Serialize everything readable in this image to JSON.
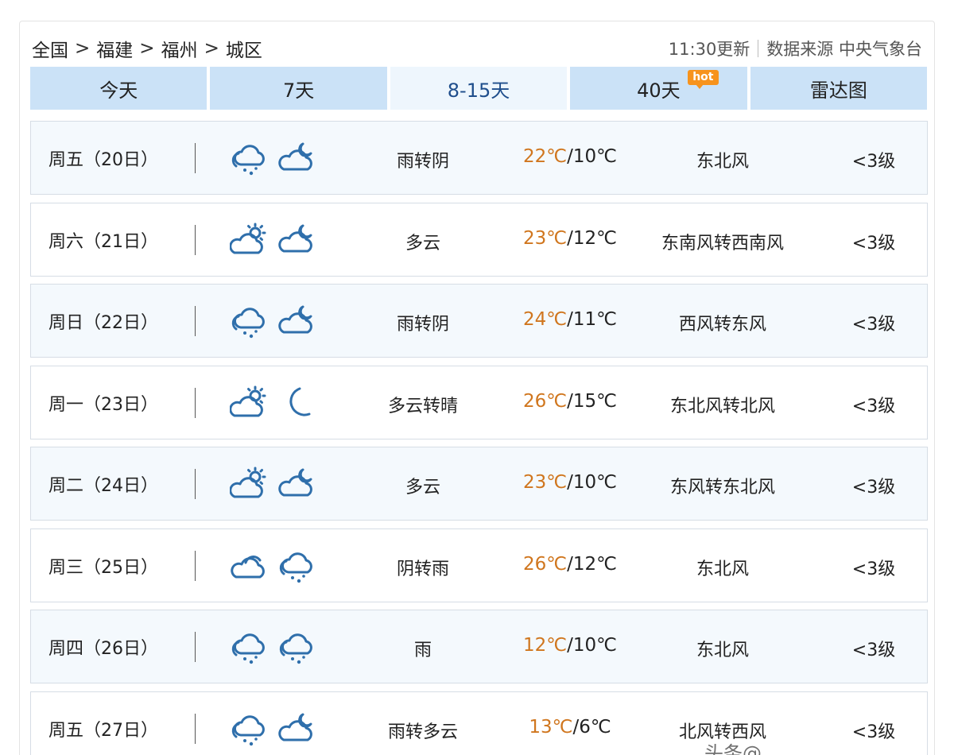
{
  "breadcrumb": [
    "全国",
    "福建",
    "福州",
    "城区"
  ],
  "breadcrumb_sep": ">",
  "update_time": "11:30更新",
  "source_label": "数据来源 中央气象台",
  "tabs": [
    {
      "label": "今天"
    },
    {
      "label": "7天"
    },
    {
      "label": "8-15天",
      "active": true
    },
    {
      "label": "40天",
      "badge": "hot"
    },
    {
      "label": "雷达图"
    }
  ],
  "forecast": [
    {
      "date": "周五（20日）",
      "icon_day": "rain-cloud-icon",
      "icon_night": "cloud-moon-icon",
      "condition": "雨转阴",
      "high": "22℃",
      "low": "10℃",
      "wind": "东北风",
      "level": "<3级"
    },
    {
      "date": "周六（21日）",
      "icon_day": "sun-cloud-icon",
      "icon_night": "cloud-moon-icon",
      "condition": "多云",
      "high": "23℃",
      "low": "12℃",
      "wind": "东南风转西南风",
      "level": "<3级"
    },
    {
      "date": "周日（22日）",
      "icon_day": "rain-cloud-icon",
      "icon_night": "cloud-moon-icon",
      "condition": "雨转阴",
      "high": "24℃",
      "low": "11℃",
      "wind": "西风转东风",
      "level": "<3级"
    },
    {
      "date": "周一（23日）",
      "icon_day": "sun-cloud-icon",
      "icon_night": "moon-icon",
      "condition": "多云转晴",
      "high": "26℃",
      "low": "15℃",
      "wind": "东北风转北风",
      "level": "<3级"
    },
    {
      "date": "周二（24日）",
      "icon_day": "sun-cloud-icon",
      "icon_night": "cloud-moon-icon",
      "condition": "多云",
      "high": "23℃",
      "low": "10℃",
      "wind": "东风转东北风",
      "level": "<3级"
    },
    {
      "date": "周三（25日）",
      "icon_day": "cloud-icon",
      "icon_night": "rain-cloud-icon",
      "condition": "阴转雨",
      "high": "26℃",
      "low": "12℃",
      "wind": "东北风",
      "level": "<3级"
    },
    {
      "date": "周四（26日）",
      "icon_day": "rain-cloud-icon",
      "icon_night": "rain-cloud-icon",
      "condition": "雨",
      "high": "12℃",
      "low": "10℃",
      "wind": "东北风",
      "level": "<3级"
    },
    {
      "date": "周五（27日）",
      "icon_day": "rain-cloud-icon",
      "icon_night": "cloud-moon-icon",
      "condition": "雨转多云",
      "high": "13℃",
      "low": "6℃",
      "wind": "北风转西风",
      "level": "<3级"
    }
  ],
  "colors": {
    "high_temp": "#d0761e",
    "icon": "#2f6fab",
    "tab_bg": "#cbe2f7",
    "tab_active_bg": "#eef6fd"
  },
  "watermark": "头条@"
}
